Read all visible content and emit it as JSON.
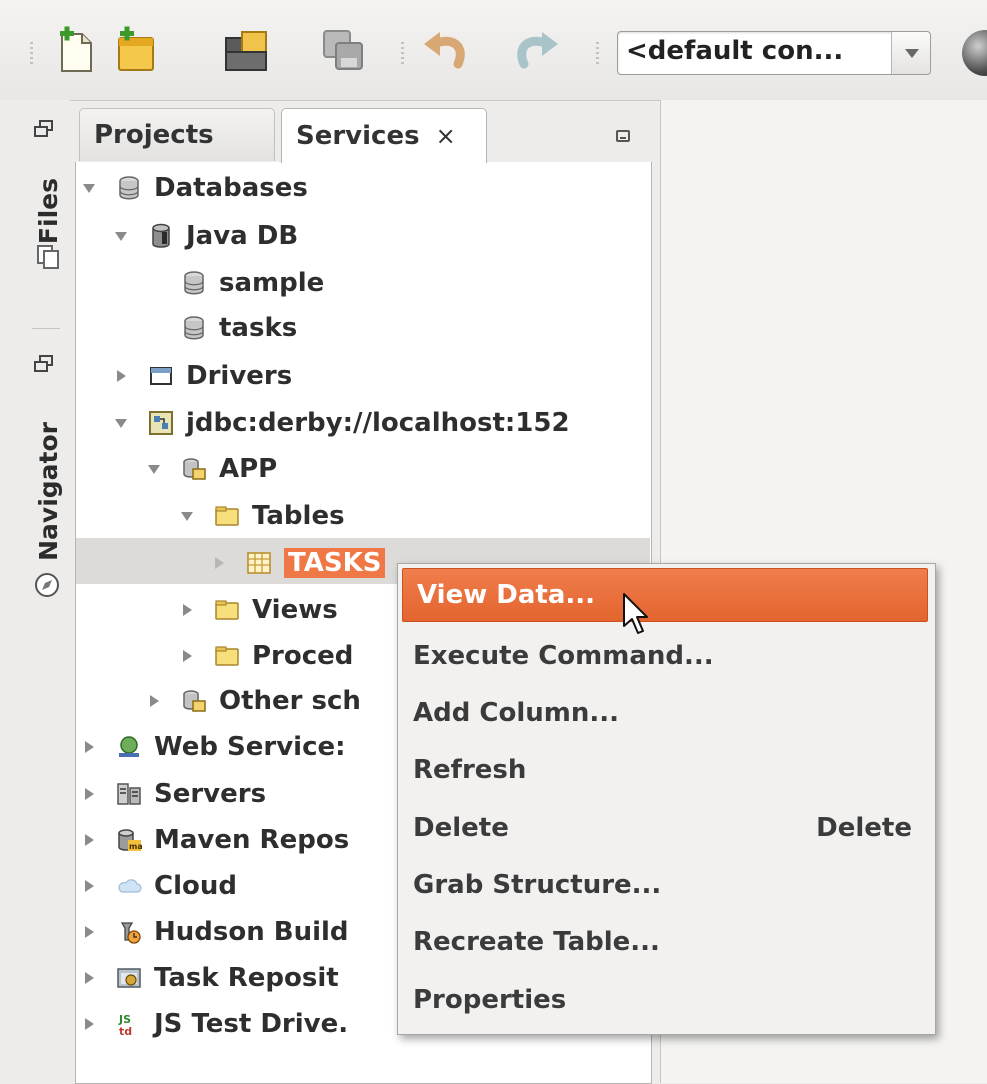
{
  "toolbar": {
    "buttons": [
      {
        "name": "new-file-icon"
      },
      {
        "name": "new-project-icon"
      },
      {
        "name": "open-project-icon"
      },
      {
        "name": "save-all-icon"
      },
      {
        "name": "undo-icon"
      },
      {
        "name": "redo-icon"
      }
    ],
    "config_value": "<default con...",
    "globe_icon": "globe-icon"
  },
  "side_strip": {
    "tabs": [
      {
        "label": "Files",
        "icon": "files-icon"
      },
      {
        "label": "Navigator",
        "icon": "compass-icon"
      }
    ]
  },
  "panel": {
    "tabs": [
      {
        "label": "Projects",
        "active": false
      },
      {
        "label": "Services",
        "active": true,
        "close": "×"
      }
    ]
  },
  "tree": {
    "items": [
      {
        "label": "Databases",
        "icon": "database-icon",
        "state": "open"
      },
      {
        "label": "Java DB",
        "icon": "java-db-icon",
        "state": "open"
      },
      {
        "label": "sample",
        "icon": "database-icon",
        "state": "none"
      },
      {
        "label": "tasks",
        "icon": "database-icon",
        "state": "none"
      },
      {
        "label": "Drivers",
        "icon": "drivers-folder-icon",
        "state": "closed"
      },
      {
        "label": "jdbc:derby://localhost:152",
        "icon": "connection-icon",
        "state": "open"
      },
      {
        "label": "APP",
        "icon": "schema-icon",
        "state": "open"
      },
      {
        "label": "Tables",
        "icon": "folder-icon",
        "state": "open"
      },
      {
        "label": "TASKS",
        "icon": "table-icon",
        "state": "closed",
        "selected": true
      },
      {
        "label": "Views",
        "icon": "folder-icon",
        "state": "closed"
      },
      {
        "label": "Proced",
        "icon": "folder-icon",
        "state": "closed"
      },
      {
        "label": "Other sch",
        "icon": "schema-icon",
        "state": "closed"
      },
      {
        "label": "Web Service:",
        "icon": "web-services-icon",
        "state": "closed"
      },
      {
        "label": "Servers",
        "icon": "servers-icon",
        "state": "closed"
      },
      {
        "label": "Maven Repos",
        "icon": "maven-icon",
        "state": "closed"
      },
      {
        "label": "Cloud",
        "icon": "cloud-icon",
        "state": "closed"
      },
      {
        "label": "Hudson Build",
        "icon": "hudson-icon",
        "state": "closed"
      },
      {
        "label": "Task Reposit",
        "icon": "task-repository-icon",
        "state": "closed"
      },
      {
        "label": "JS Test Drive.",
        "icon": "js-test-driver-icon",
        "state": "closed"
      }
    ]
  },
  "context_menu": {
    "items": [
      {
        "label": "View Data...",
        "highlighted": true
      },
      {
        "label": "Execute Command..."
      },
      {
        "label": "Add Column..."
      },
      {
        "label": "Refresh"
      },
      {
        "label": "Delete",
        "shortcut": "Delete"
      },
      {
        "label": "Grab Structure..."
      },
      {
        "label": "Recreate Table..."
      },
      {
        "label": "Properties"
      }
    ]
  },
  "colors": {
    "selection": "#f07746",
    "menu_highlight": "#e8693a",
    "background": "#edeceb"
  }
}
